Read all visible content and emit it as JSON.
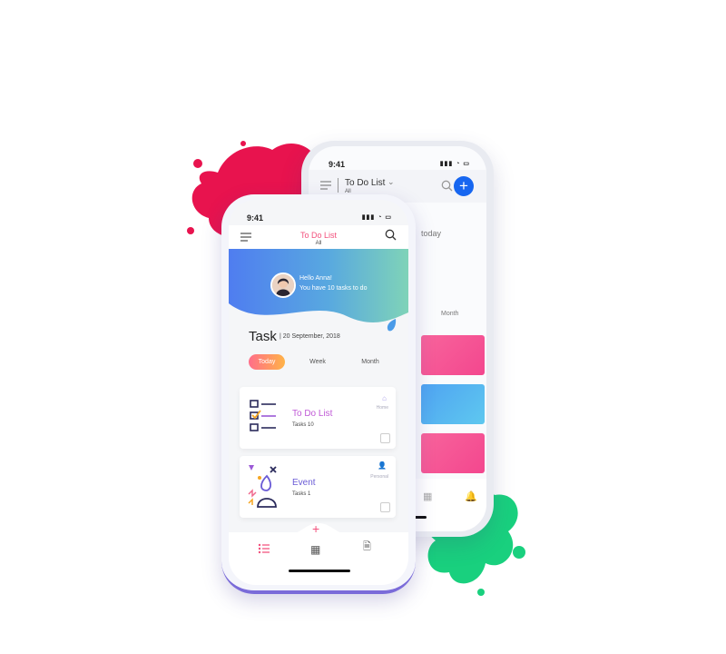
{
  "colors": {
    "accent_pink": "#f2507c",
    "accent_blue": "#1766f0",
    "splash_red": "#e8134e",
    "splash_green": "#19d07e"
  },
  "back_phone": {
    "status_time": "9:41",
    "title": "To Do List",
    "subtitle": "All",
    "partial_text": "today",
    "tab_month": "Month",
    "icons": [
      "menu-icon",
      "chevron-down-icon",
      "search-icon",
      "plus-icon",
      "calendar-icon",
      "bell-icon"
    ]
  },
  "front_phone": {
    "status_time": "9:41",
    "header": {
      "title": "To Do List",
      "subtitle": "All"
    },
    "greeting": {
      "hello": "Hello Anna!",
      "summary": "You have 10 tasks to do"
    },
    "task_heading": "Task",
    "task_date": "| 20 September, 2018",
    "tabs": [
      "Today",
      "Week",
      "Month"
    ],
    "active_tab": "Today",
    "cards": [
      {
        "title": "To Do List",
        "count": "Tasks 10",
        "tag": "Home",
        "title_color": "#c05ad6"
      },
      {
        "title": "Event",
        "count": "Tasks 1",
        "tag": "Personal",
        "title_color": "#6a5bd6"
      }
    ],
    "bottom_icons": [
      "list-icon",
      "calendar-icon",
      "settings-doc-icon"
    ],
    "fab_icon": "plus-icon"
  }
}
